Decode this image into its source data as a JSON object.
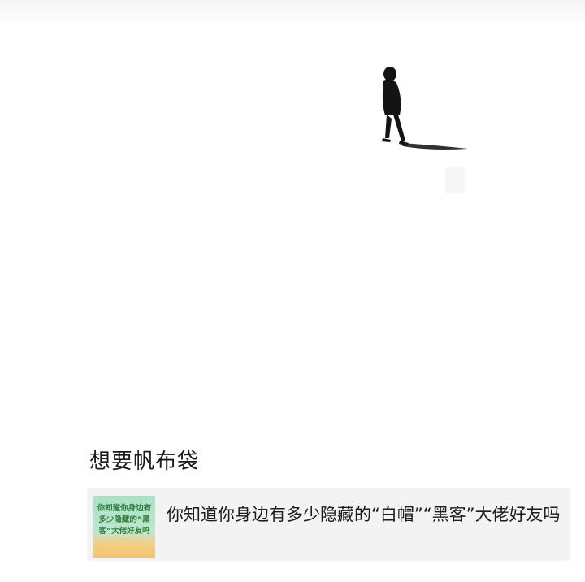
{
  "post": {
    "caption": "想要帆布袋",
    "image": {
      "subject": "person-walking-icon"
    },
    "link_card": {
      "title": "你知道你身边有多少隐藏的“白帽”“黑客”大佬好友吗",
      "thumbnail_text": "你知道你身边有多少隐藏的“黑客”大佬好友吗",
      "thumbnail_colors": [
        "#a9e1c6",
        "#f1c26f"
      ]
    }
  },
  "colors": {
    "background": "#ffffff",
    "card_background": "#f3f3f3",
    "text": "#1a1a1a",
    "thumb_text": "#2f7d3a"
  }
}
